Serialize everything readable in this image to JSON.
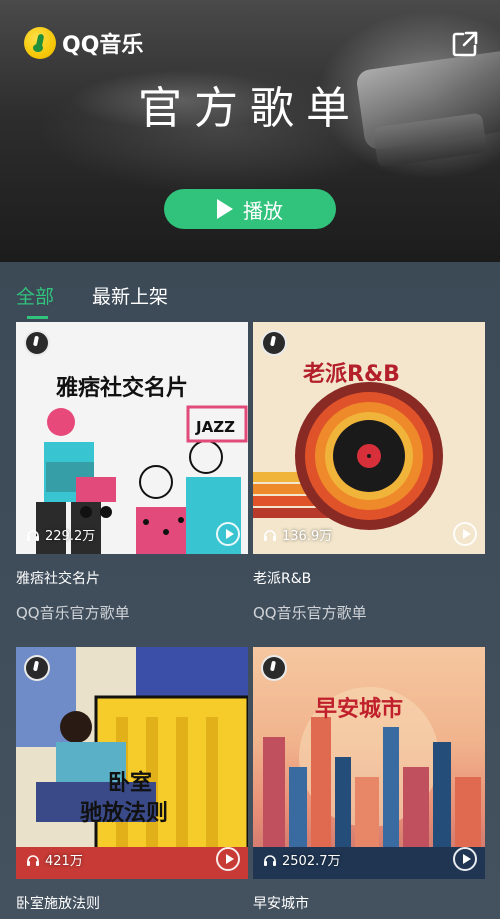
{
  "header": {
    "logo_text": "QQ音乐",
    "title": "官方歌单",
    "play_label": "播放",
    "share_icon": "share-icon"
  },
  "tabs": [
    {
      "label": "全部",
      "active": true
    },
    {
      "label": "最新上架",
      "active": false
    }
  ],
  "playlists": [
    {
      "cover_title": "雅痞社交名片",
      "title": "雅痞社交名片",
      "subtitle": "QQ音乐官方歌单",
      "plays": "229.2万",
      "cover_extra": "JAZZ"
    },
    {
      "cover_title": "老派R&B",
      "title": "老派R&B",
      "subtitle": "QQ音乐官方歌单",
      "plays": "136.9万"
    },
    {
      "cover_title_line1": "卧室",
      "cover_title_line2": "驰放法则",
      "title": "卧室施放法则",
      "plays": "421万"
    },
    {
      "cover_title": "早安城市",
      "title": "早安城市",
      "plays": "2502.7万"
    }
  ],
  "colors": {
    "accent": "#31c27c",
    "background": "#3d4a57"
  }
}
